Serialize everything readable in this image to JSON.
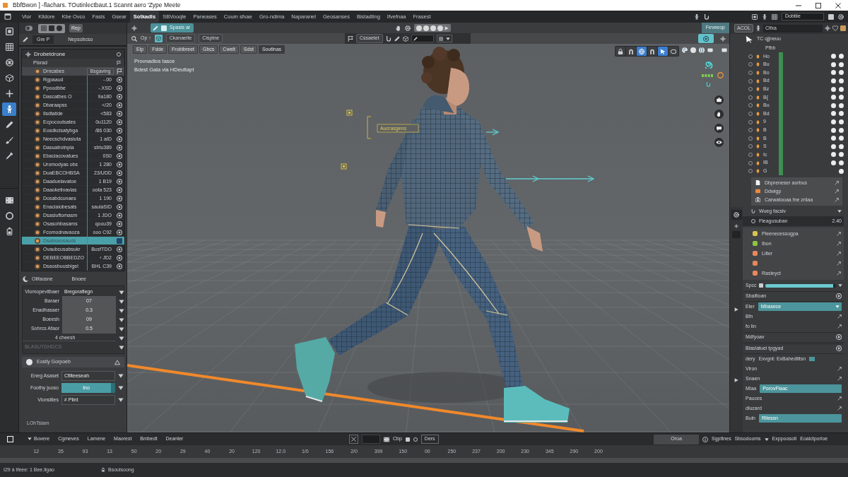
{
  "window": {
    "title": "BbfBwon ] -flachars. TOutinlectbaut.1 Scannt aero 'Zype Meete"
  },
  "menu": [
    {
      "label": "Vior",
      "selected": false
    },
    {
      "label": "Kildore",
      "selected": false
    },
    {
      "label": "Kbe Ovco",
      "selected": false
    },
    {
      "label": "Fasis",
      "selected": false
    },
    {
      "label": "Gsear",
      "selected": false
    },
    {
      "label": "Sotkadls",
      "selected": true
    },
    {
      "label": "SBVooqte",
      "selected": false
    },
    {
      "label": "Paneases",
      "selected": false
    },
    {
      "label": "Coum sfvae",
      "selected": false
    },
    {
      "label": "Gro-ndima",
      "selected": false
    },
    {
      "label": "Naparanel",
      "selected": false
    },
    {
      "label": "Geosanses",
      "selected": false
    },
    {
      "label": "Bistadting",
      "selected": false
    },
    {
      "label": "Ifvefnaa",
      "selected": false
    },
    {
      "label": "Frasest",
      "selected": false
    }
  ],
  "header_field": {
    "value": "Dobtiie"
  },
  "tool_groups": [
    [
      {
        "kind": "box",
        "selected": false
      },
      {
        "kind": "grid",
        "selected": false
      },
      {
        "kind": "orbit",
        "selected": false
      },
      {
        "kind": "cube",
        "selected": false
      },
      {
        "kind": "plus",
        "selected": false
      },
      {
        "kind": "figure",
        "selected": true
      },
      {
        "kind": "pen",
        "selected": false
      },
      {
        "kind": "brush",
        "selected": false
      },
      {
        "kind": "pipette",
        "selected": false
      }
    ],
    [
      {
        "kind": "film",
        "selected": false
      },
      {
        "kind": "ring",
        "selected": false
      },
      {
        "kind": "battery",
        "selected": false
      }
    ]
  ],
  "left_panel": {
    "button": "Rep",
    "tabs": [
      {
        "label": "Gre P",
        "selected": true
      },
      {
        "label": "Nepsobcso",
        "selected": false
      }
    ],
    "outliner": {
      "title": "Drobetdrone",
      "group": "Pisrad",
      "head": {
        "name": "Drncabes",
        "value": "Bsgaving"
      },
      "rows": [
        {
          "name": "Rgpaaud",
          "value": "-.00",
          "selected": false
        },
        {
          "name": "Ppoodbbe",
          "value": "-.XSD",
          "selected": false
        },
        {
          "name": "Dascatbes O",
          "value": "9a180",
          "selected": false
        },
        {
          "name": "Dbaraapss",
          "value": "</20",
          "selected": false
        },
        {
          "name": "Ilsdtatide",
          "value": "<583",
          "selected": false
        },
        {
          "name": "Ecpocoutsates",
          "value": "0u1120",
          "selected": false
        },
        {
          "name": "Eosdkcisatybga",
          "value": "/86 030",
          "selected": false
        },
        {
          "name": "Neecschdvasiuta",
          "value": "1 aID",
          "selected": false
        },
        {
          "name": "Dasuatrotnpia",
          "value": "sbtu389",
          "selected": false
        },
        {
          "name": "Ebaciacovatues",
          "value": "0S0",
          "selected": false
        },
        {
          "name": "Uromodyas obs",
          "value": "1 280",
          "selected": false
        },
        {
          "name": "DuaEBCOHBSA",
          "value": "23/UDD",
          "selected": false
        },
        {
          "name": "Daaduelavatoe",
          "value": "1 B19",
          "selected": false
        },
        {
          "name": "Daaoketivavias",
          "value": "oota 523",
          "selected": false
        },
        {
          "name": "Dosabdcunaes",
          "value": "1 190",
          "selected": false
        },
        {
          "name": "Enaciaiobesats",
          "value": "saulaSID",
          "selected": false
        },
        {
          "name": "Dsasiuftomasm",
          "value": "1 JDO",
          "selected": false
        },
        {
          "name": "Osasohbasams",
          "value": "qoou39",
          "selected": false
        },
        {
          "name": "Fcomodnavaoza",
          "value": "ooo C92",
          "selected": false
        },
        {
          "name": "Dsabsaosauds",
          "selected": true
        },
        {
          "name": "Ovaubcusabsukr",
          "value": "BusfTDO",
          "selected": false
        },
        {
          "name": "DEBEEOBBEDZO",
          "value": "‹ JD2",
          "selected": false
        },
        {
          "name": "Dsaosbuusbigel",
          "value": "BHL C39",
          "selected": false
        }
      ]
    },
    "properties": {
      "headings": [
        "Olifaosne",
        "Bnoee"
      ],
      "rows": [
        {
          "kind": "dropdown",
          "label": "Vlomopevitbaer",
          "value": "Bregoraflegn"
        },
        {
          "kind": "number",
          "label": "Baraer",
          "value": "07"
        },
        {
          "kind": "number",
          "label": "Enadhasaer",
          "value": "0.3"
        },
        {
          "kind": "number",
          "label": "Boeesh",
          "value": "09"
        },
        {
          "kind": "number",
          "label": "Sohrcs Afaor",
          "value": "0.5"
        },
        {
          "kind": "option",
          "label": "4 cheesh"
        },
        {
          "kind": "dim",
          "label": "BLASUTDHDCS"
        }
      ]
    },
    "section": {
      "title": "Eoslly Gorpoeb",
      "expanded": true,
      "rows": [
        {
          "kind": "dropdown",
          "label": "Eneg Asaset",
          "value": "Cfilteeseah"
        },
        {
          "kind": "active",
          "label": "Foothy juoso",
          "value": "Ino"
        },
        {
          "kind": "dropdown",
          "label": "Vionsitles",
          "value": "≠ Plint"
        }
      ],
      "footer": "LOhTslam"
    }
  },
  "viewport": {
    "bar_1": {
      "toggle": "Spasis ar",
      "mode": "Feveeop"
    },
    "bar_2": {
      "menu": "Op ↑",
      "buttons": [
        "Ckanaeite",
        "Cisptne"
      ],
      "tool": "Cssaetet"
    },
    "tabs": [
      {
        "label": "Elp",
        "selected": false
      },
      {
        "label": "Fdde",
        "selected": false
      },
      {
        "label": "Froblbreet",
        "selected": false
      },
      {
        "label": "Gbcs",
        "selected": false
      },
      {
        "label": "Cwelt",
        "selected": false
      },
      {
        "label": "Sdst",
        "selected": false
      },
      {
        "label": "Soutlnas",
        "selected": true
      }
    ],
    "notes": [
      "Provnadlos tasce",
      "Bdest Gala via HDeuttapt"
    ],
    "view_buttons": [
      {
        "selected": false
      },
      {
        "selected": false
      },
      {
        "selected": true
      },
      {
        "selected": false
      },
      {
        "selected": true
      },
      {
        "selected": false
      }
    ],
    "annotation": "Aucrasgens"
  },
  "right_panel": {
    "tab": "ACOL",
    "search": "Clfxa",
    "path": "TC qjjneuu",
    "group": "Pfbb",
    "rows": [
      {
        "label": "Ho",
        "visible": true
      },
      {
        "label": "Bu",
        "visible": true
      },
      {
        "label": "Bo",
        "visible": true
      },
      {
        "label": "Bd",
        "visible": true
      },
      {
        "label": "Bz",
        "visible": true
      },
      {
        "label": "B{",
        "visible": true
      },
      {
        "label": "Bu",
        "visible": true
      },
      {
        "label": "Bd",
        "visible": true
      },
      {
        "label": "9",
        "visible": true
      },
      {
        "label": "B",
        "visible": true
      },
      {
        "label": "B",
        "visible": true
      },
      {
        "label": "S",
        "visible": true
      },
      {
        "label": "Ic",
        "visible": true
      },
      {
        "label": "IB",
        "visible": true
      },
      {
        "label": "G",
        "visible": false
      }
    ],
    "popup": [
      {
        "kind": "page",
        "label": "Dbpreneser aorbus"
      },
      {
        "kind": "swatch",
        "label": "Ddwigp"
      },
      {
        "kind": "camera",
        "label": "Carwatooaa fne zriiaa"
      }
    ],
    "props": [
      {
        "label": "Wueg facsiv"
      },
      {
        "label": "Fleagusuban",
        "value": "2.40"
      }
    ],
    "layers": [
      {
        "label": "Pleenecessogpa",
        "color": "#d8c44c"
      },
      {
        "label": "Ibon",
        "color": "#8dc63f"
      },
      {
        "label": "Liiter",
        "color": "#e8875c"
      },
      {
        "color": "#e8875c"
      },
      {
        "label": "Rasleyct",
        "color": "#e8875c"
      }
    ],
    "slider": {
      "label": "Spcc",
      "level": 0.96
    },
    "settings": [
      {
        "kind": "section",
        "label": "Sbaifioan"
      },
      {
        "kind": "dropdown",
        "label": "Eter",
        "value": "Mbasece"
      },
      {
        "kind": "plain",
        "label": "Bfn"
      },
      {
        "kind": "plain",
        "label": "fo lin"
      },
      {
        "kind": "section",
        "label": "Mdfyoav"
      },
      {
        "kind": "section",
        "label": "Blaslatuel tpgyad"
      },
      {
        "kind": "value",
        "label": "dery",
        "value": "Exvgnt: ExBahedtltsn"
      },
      {
        "kind": "plain",
        "label": "Viron"
      },
      {
        "kind": "plain",
        "label": "Snaen"
      },
      {
        "kind": "field",
        "label": "Mlaa",
        "value": "PorovFlaac"
      },
      {
        "kind": "plain",
        "label": "Pauces"
      },
      {
        "kind": "plain",
        "label": "dluzard"
      },
      {
        "kind": "field",
        "label": "Buln",
        "value": "Rilessn"
      }
    ]
  },
  "timeline": {
    "tabs": [
      "Bovere",
      "Cgmeves",
      "Lamene",
      "Maorest",
      "Bmbedt",
      "Deanter"
    ],
    "field_buttons": [
      "Cbp",
      "Ders"
    ],
    "button": "Oroa",
    "links": [
      "Sgpttnes",
      "Sbsodooms",
      "Exppoosolt",
      "Eoalctporioe"
    ],
    "ticks": [
      "12",
      "35",
      "93",
      "13",
      "50",
      "20",
      "29",
      "40",
      "20",
      "120",
      "12.0",
      "1/0",
      "156",
      "2/0",
      "399",
      "150",
      "00",
      "250",
      "237",
      "200",
      "230",
      "345",
      "290",
      "200"
    ],
    "status": "I29 à tfeee: 1 Bee.ligao",
    "status_2": "Bsoulsoong"
  }
}
